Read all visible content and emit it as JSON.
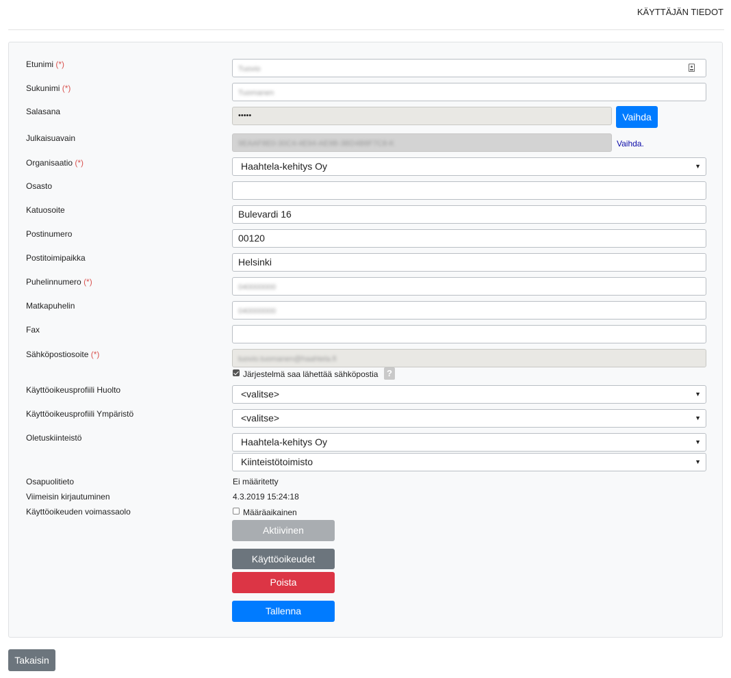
{
  "header": {
    "title": "KÄYTTÄJÄN TIEDOT"
  },
  "required_mark": "(*)",
  "form": {
    "firstname": {
      "label": "Etunimi",
      "value": "Tuovio"
    },
    "lastname": {
      "label": "Sukunimi",
      "value": "Tuomanen"
    },
    "password": {
      "label": "Salasana",
      "value": "•••••",
      "button": "Vaihda"
    },
    "publish_key": {
      "label": "Julkaisuavain",
      "value": "9EAAF8E0-30C4-4E94-AE9B-3BD4B8F7C8-K",
      "link": "Vaihda."
    },
    "organization": {
      "label": "Organisaatio",
      "value": "Haahtela-kehitys Oy"
    },
    "department": {
      "label": "Osasto",
      "value": ""
    },
    "street": {
      "label": "Katuosoite",
      "value": "Bulevardi 16"
    },
    "postal_code": {
      "label": "Postinumero",
      "value": "00120"
    },
    "city": {
      "label": "Postitoimipaikka",
      "value": "Helsinki"
    },
    "phone": {
      "label": "Puhelinnumero",
      "value": "040000000"
    },
    "mobile": {
      "label": "Matkapuhelin",
      "value": "040000000"
    },
    "fax": {
      "label": "Fax",
      "value": ""
    },
    "email": {
      "label": "Sähköpostiosoite",
      "value": "tuovio.tuomanen@haahtela.fi"
    },
    "email_permission": {
      "label": "Järjestelmä saa lähettää sähköpostia",
      "checked": true,
      "help": "?"
    },
    "profile_maintenance": {
      "label": "Käyttöoikeusprofiili Huolto",
      "value": "<valitse>"
    },
    "profile_environment": {
      "label": "Käyttöoikeusprofiili Ympäristö",
      "value": "<valitse>"
    },
    "default_property": {
      "label": "Oletuskiinteistö",
      "value1": "Haahtela-kehitys Oy",
      "value2": "Kiinteistötoimisto"
    },
    "party_info": {
      "label": "Osapuolitieto",
      "value": "Ei määritetty"
    },
    "last_login": {
      "label": "Viimeisin kirjautuminen",
      "value": "4.3.2019 15:24:18"
    },
    "validity": {
      "label": "Käyttöoikeuden voimassaolo",
      "checkbox_label": "Määräaikainen",
      "checked": false
    }
  },
  "buttons": {
    "active": "Aktiivinen",
    "rights": "Käyttöoikeudet",
    "delete": "Poista",
    "save": "Tallenna",
    "back": "Takaisin"
  },
  "colors": {
    "primary": "#007bff",
    "secondary": "#6c757d",
    "danger": "#dc3545",
    "disabled": "#a9adb1"
  }
}
